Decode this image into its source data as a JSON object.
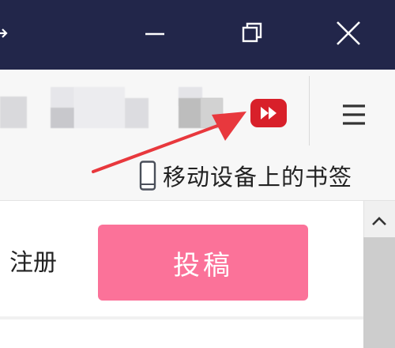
{
  "window": {
    "controls": {
      "minimize_icon": "minimize-icon",
      "restore_icon": "restore-icon",
      "close_icon": "close-icon"
    },
    "titlebar_color": "#22264a"
  },
  "toolbar": {
    "extension_icon": "fast-forward-icon",
    "extension_color": "#d8202a",
    "menu_icon": "hamburger-menu-icon"
  },
  "bookmarks": {
    "mobile_label": "移动设备上的书签",
    "mobile_icon": "mobile-phone-icon"
  },
  "page": {
    "register_label": "注册",
    "submit_label": "投稿",
    "submit_color": "#fb7299"
  },
  "annotation": {
    "arrow_color": "#e8383d"
  }
}
